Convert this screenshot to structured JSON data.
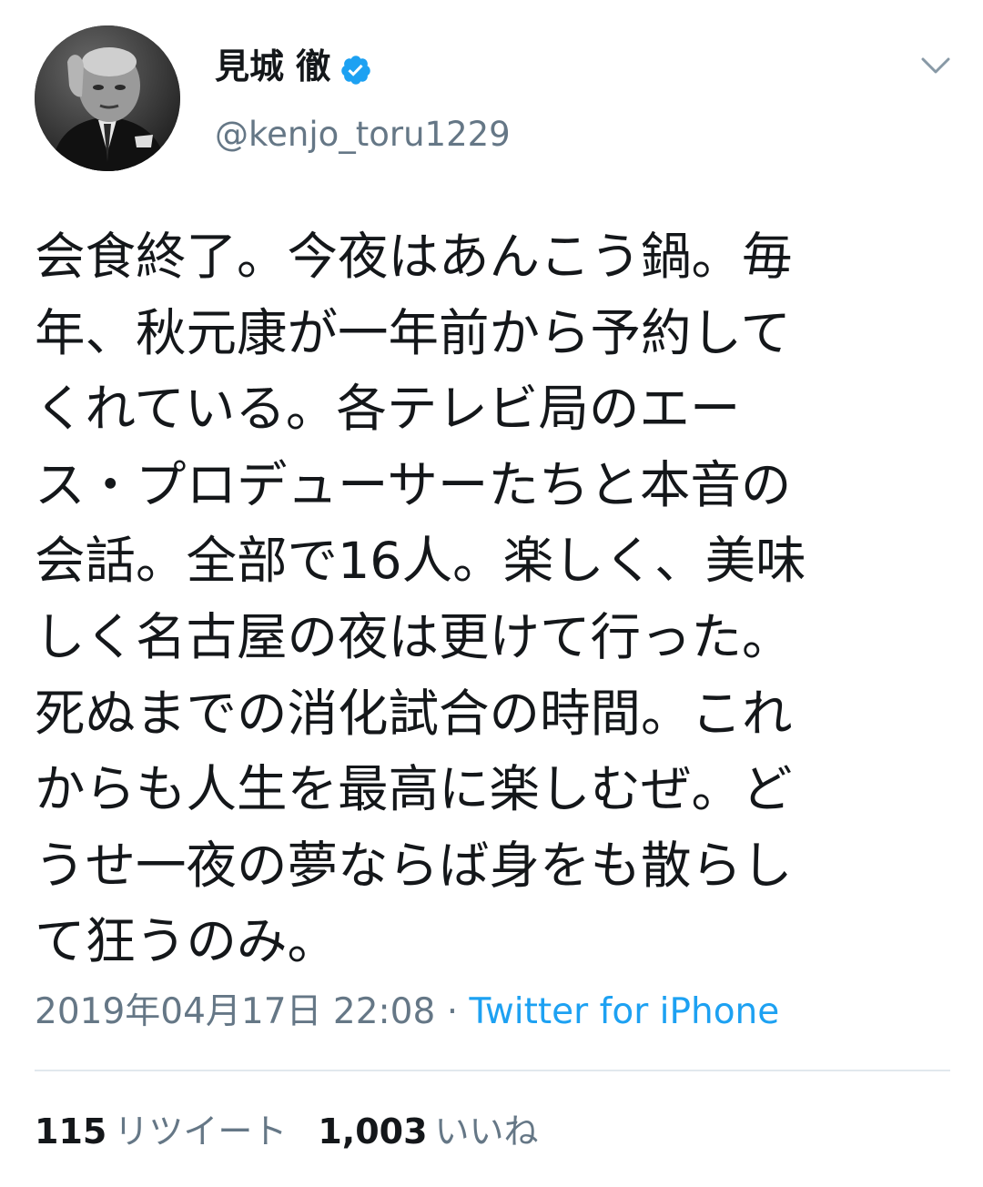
{
  "tweet": {
    "author": {
      "display_name": "見城 徹",
      "handle": "@kenjo_toru1229",
      "verified": true,
      "avatar_icon": "profile-photo"
    },
    "menu_icon": "chevron-down-icon",
    "text_lines": [
      "会食終了。今夜はあんこう鍋。毎",
      "年、秋元康が一年前から予約して",
      "くれている。各テレビ局のエー",
      "ス・プロデューサーたちと本音の",
      "会話。全部で16人。楽しく、美味",
      "しく名古屋の夜は更けて行った。",
      "死ぬまでの消化試合の時間。これ",
      "からも人生を最高に楽しむぜ。ど",
      "うせ一夜の夢ならば身をも散らし",
      "て狂うのみ。"
    ],
    "timestamp": "2019年04月17日 22:08",
    "separator": " · ",
    "source": "Twitter for iPhone",
    "stats": {
      "retweets_count": "115",
      "retweets_label": "リツイート",
      "likes_count": "1,003",
      "likes_label": "いいね"
    }
  },
  "colors": {
    "text_primary": "#14171a",
    "text_secondary": "#657786",
    "accent": "#1da1f2",
    "divider": "#e1e8ed"
  }
}
